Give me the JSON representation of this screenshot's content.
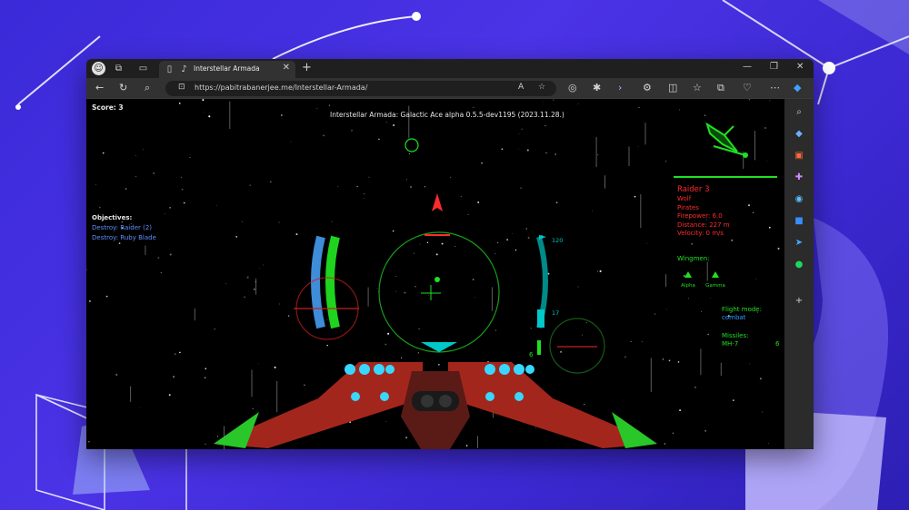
{
  "browser": {
    "tab_title": "Interstellar Armada",
    "url": "https://pabitrabanerjee.me/Interstellar-Armada/"
  },
  "game": {
    "score_text": "Score: 3",
    "title_text": "Interstellar Armada: Galactic Ace alpha 0.5.5-dev1195 (2023.11.28.)",
    "objectives": {
      "heading": "Objectives:",
      "items": [
        "Destroy: Raider (2)",
        "Destroy: Ruby Blade"
      ]
    },
    "target": {
      "name": "Raider 3",
      "lines": [
        "Wolf",
        "Pirates",
        "Firepower: 6.0",
        "Distance: 227 m",
        "Velocity: 0 m/s"
      ]
    },
    "wingmen": {
      "label": "Wingmen:",
      "names": [
        "Alpha",
        "Gamma"
      ]
    },
    "flight_mode": {
      "label": "Flight mode:",
      "value": "combat"
    },
    "missiles": {
      "label": "Missiles:",
      "type": "MH-7",
      "count": "6"
    },
    "hud": {
      "speed_value": "120",
      "speed_low": "17",
      "missile_hud_count": "6"
    },
    "colors": {
      "hud_green": "#20e020",
      "hud_red": "#ff2b2b",
      "hud_cyan": "#00c8c8",
      "objective_blue": "#5f8fff",
      "ship_red": "#b02a20",
      "engine_blue": "#39d6ff"
    }
  },
  "icons": {
    "tabbar": [
      "profile-icon",
      "workspaces-icon",
      "tab-actions-icon",
      "page-icon",
      "audio-icon"
    ],
    "nav": [
      "back-icon",
      "refresh-icon",
      "search-icon",
      "lock-icon",
      "read-aloud-icon",
      "favorite-icon"
    ],
    "sidebar": [
      "search-icon",
      "tag-icon",
      "briefcase-icon",
      "tools-icon",
      "copilot-icon",
      "outlook-icon",
      "telegram-icon",
      "spotify-icon",
      "add-icon"
    ]
  }
}
